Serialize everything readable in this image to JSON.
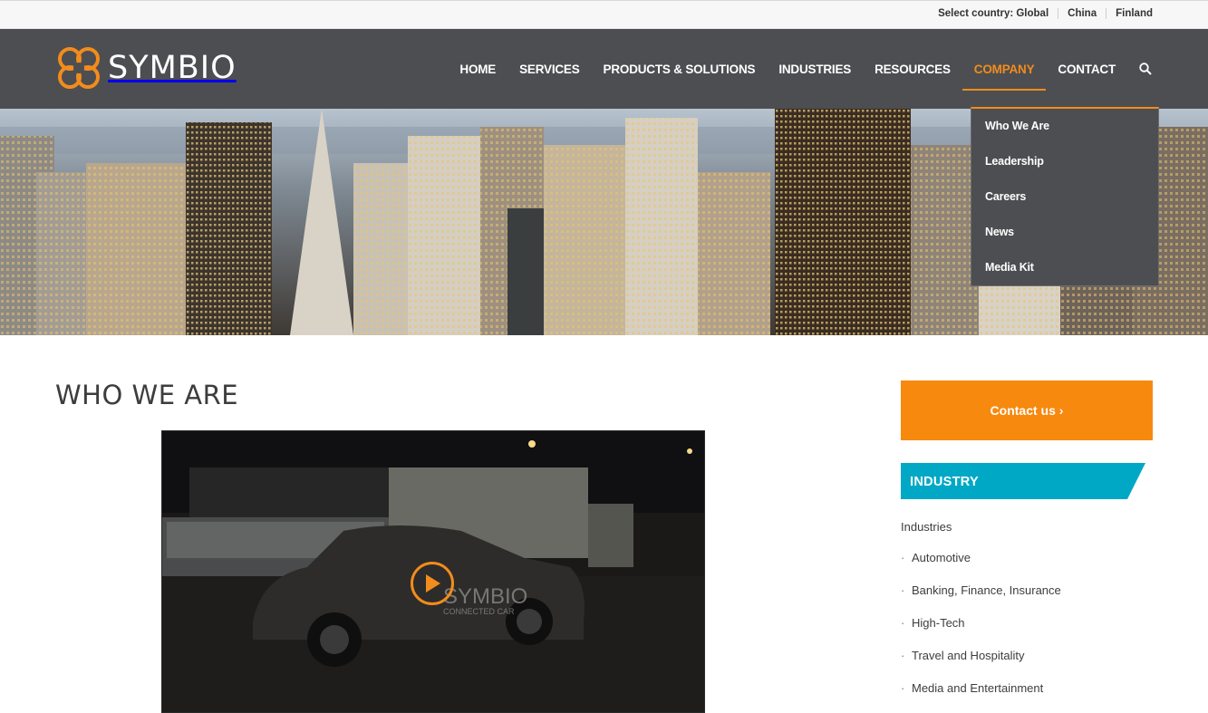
{
  "topbar": {
    "select_label": "Select country: Global",
    "countries": [
      "China",
      "Finland"
    ]
  },
  "logo": {
    "text": "SYMBIO",
    "icon": "symbio-knot-icon",
    "color": "#f28c1c"
  },
  "nav": {
    "items": [
      "HOME",
      "SERVICES",
      "PRODUCTS & SOLUTIONS",
      "INDUSTRIES",
      "RESOURCES",
      "COMPANY",
      "CONTACT"
    ],
    "active": "COMPANY",
    "search_icon": "search-icon"
  },
  "dropdown": {
    "items": [
      "Who We Are",
      "Leadership",
      "Careers",
      "News",
      "Media Kit"
    ]
  },
  "main": {
    "title": "WHO WE ARE",
    "video": {
      "overlay_brand": "SYMBIO",
      "overlay_sub": "CONNECTED CAR",
      "play_icon": "play-icon"
    }
  },
  "sidebar": {
    "contact_label": "Contact us ›",
    "industry_heading": "INDUSTRY",
    "industries_label": "Industries",
    "industries": [
      "Automotive",
      "Banking, Finance, Insurance",
      "High-Tech",
      "Travel and Hospitality",
      "Media and Entertainment"
    ]
  },
  "colors": {
    "accent": "#f28c1c",
    "header_bg": "#4d4e51",
    "industry_bg": "#00a8c6"
  }
}
